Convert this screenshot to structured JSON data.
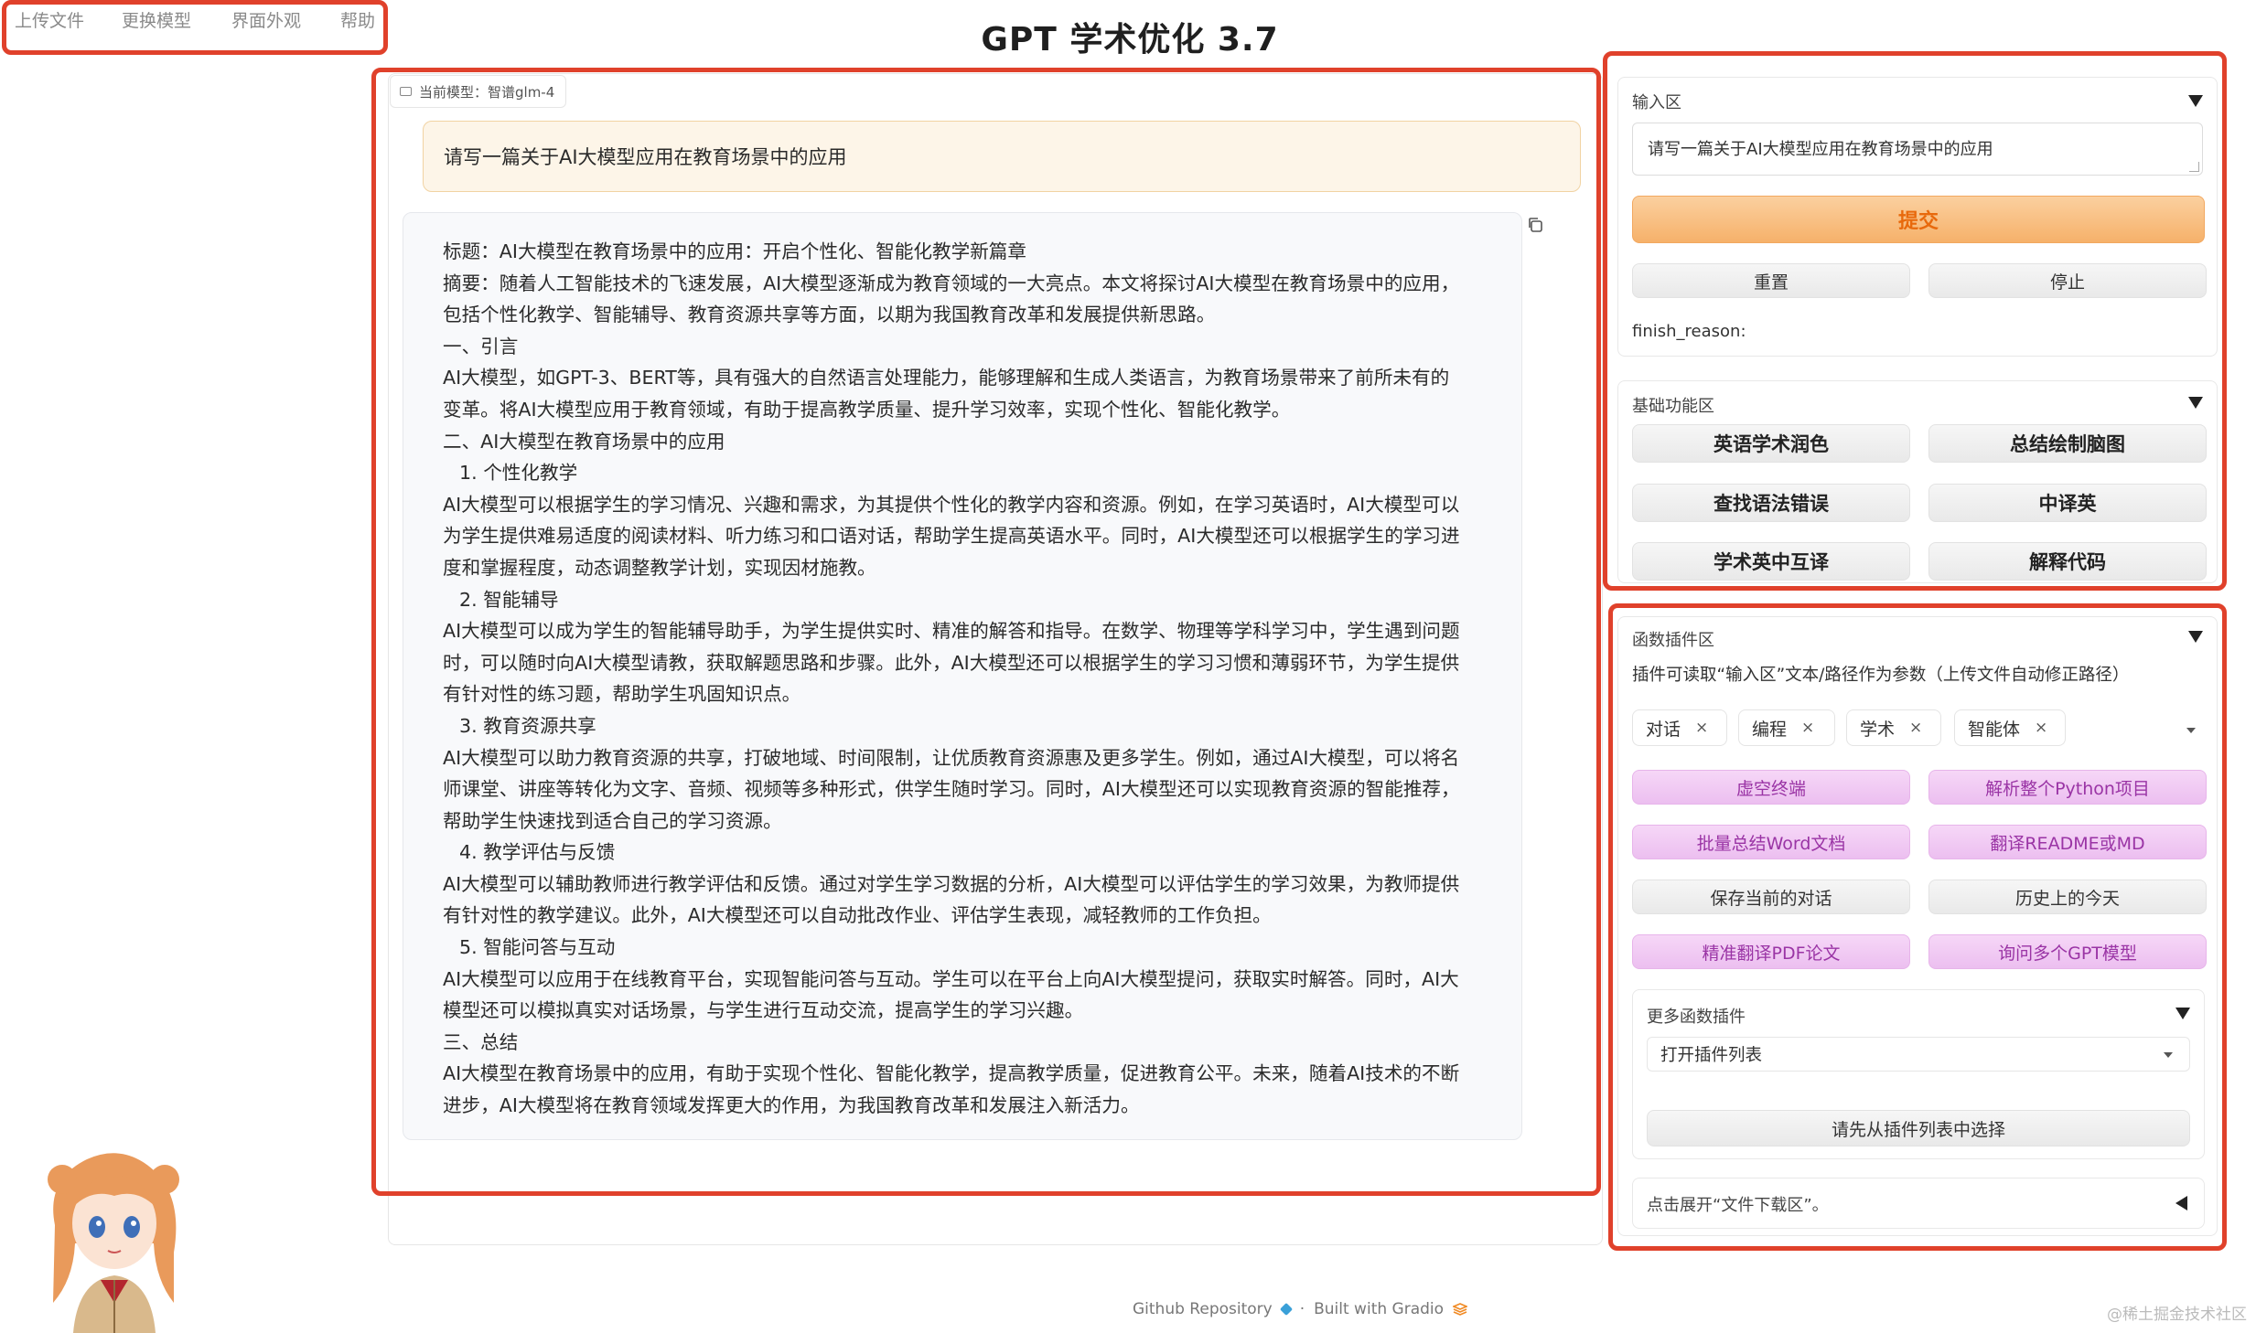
{
  "menu": [
    "上传文件",
    "更换模型",
    "界面外观",
    "帮助"
  ],
  "title": "GPT 学术优化 3.7",
  "chat": {
    "model_tag": "当前模型：智谱glm-4",
    "user_message": "请写一篇关于AI大模型应用在教育场景中的应用",
    "answer_lines": [
      {
        "text": "标题：AI大模型在教育场景中的应用：开启个性化、智能化教学新篇章",
        "indent": false
      },
      {
        "text": "摘要：随着人工智能技术的飞速发展，AI大模型逐渐成为教育领域的一大亮点。本文将探讨AI大模型在教育场景中的应用，",
        "indent": false
      },
      {
        "text": "包括个性化教学、智能辅导、教育资源共享等方面，以期为我国教育改革和发展提供新思路。",
        "indent": false
      },
      {
        "text": "一、引言",
        "indent": false
      },
      {
        "text": "AI大模型，如GPT-3、BERT等，具有强大的自然语言处理能力，能够理解和生成人类语言，为教育场景带来了前所未有的",
        "indent": false
      },
      {
        "text": "变革。将AI大模型应用于教育领域，有助于提高教学质量、提升学习效率，实现个性化、智能化教学。",
        "indent": false
      },
      {
        "text": "二、AI大模型在教育场景中的应用",
        "indent": false
      },
      {
        "text": "1. 个性化教学",
        "indent": true
      },
      {
        "text": "AI大模型可以根据学生的学习情况、兴趣和需求，为其提供个性化的教学内容和资源。例如，在学习英语时，AI大模型可以",
        "indent": false
      },
      {
        "text": "为学生提供难易适度的阅读材料、听力练习和口语对话，帮助学生提高英语水平。同时，AI大模型还可以根据学生的学习进",
        "indent": false
      },
      {
        "text": "度和掌握程度，动态调整教学计划，实现因材施教。",
        "indent": false
      },
      {
        "text": "2. 智能辅导",
        "indent": true
      },
      {
        "text": "AI大模型可以成为学生的智能辅导助手，为学生提供实时、精准的解答和指导。在数学、物理等学科学习中，学生遇到问题",
        "indent": false
      },
      {
        "text": "时，可以随时向AI大模型请教，获取解题思路和步骤。此外，AI大模型还可以根据学生的学习习惯和薄弱环节，为学生提供",
        "indent": false
      },
      {
        "text": "有针对性的练习题，帮助学生巩固知识点。",
        "indent": false
      },
      {
        "text": "3. 教育资源共享",
        "indent": true
      },
      {
        "text": "AI大模型可以助力教育资源的共享，打破地域、时间限制，让优质教育资源惠及更多学生。例如，通过AI大模型，可以将名",
        "indent": false
      },
      {
        "text": "师课堂、讲座等转化为文字、音频、视频等多种形式，供学生随时学习。同时，AI大模型还可以实现教育资源的智能推荐，",
        "indent": false
      },
      {
        "text": "帮助学生快速找到适合自己的学习资源。",
        "indent": false
      },
      {
        "text": "4. 教学评估与反馈",
        "indent": true
      },
      {
        "text": "AI大模型可以辅助教师进行教学评估和反馈。通过对学生学习数据的分析，AI大模型可以评估学生的学习效果，为教师提供",
        "indent": false
      },
      {
        "text": "有针对性的教学建议。此外，AI大模型还可以自动批改作业、评估学生表现，减轻教师的工作负担。",
        "indent": false
      },
      {
        "text": "5. 智能问答与互动",
        "indent": true
      },
      {
        "text": "AI大模型可以应用于在线教育平台，实现智能问答与互动。学生可以在平台上向AI大模型提问，获取实时解答。同时，AI大",
        "indent": false
      },
      {
        "text": "模型还可以模拟真实对话场景，与学生进行互动交流，提高学生的学习兴趣。",
        "indent": false
      },
      {
        "text": "三、总结",
        "indent": false
      },
      {
        "text": "AI大模型在教育场景中的应用，有助于实现个性化、智能化教学，提高教学质量，促进教育公平。未来，随着AI技术的不断",
        "indent": false
      },
      {
        "text": "进步，AI大模型将在教育领域发挥更大的作用，为我国教育改革和发展注入新活力。",
        "indent": false
      }
    ]
  },
  "input_area": {
    "label": "输入区",
    "value": "请写一篇关于AI大模型应用在教育场景中的应用",
    "submit": "提交",
    "reset": "重置",
    "stop": "停止",
    "finish_reason": "finish_reason:"
  },
  "basic": {
    "label": "基础功能区",
    "buttons": [
      "英语学术润色",
      "总结绘制脑图",
      "查找语法错误",
      "中译英",
      "学术英中互译",
      "解释代码"
    ]
  },
  "plugins": {
    "label": "函数插件区",
    "desc": "插件可读取“输入区”文本/路径作为参数（上传文件自动修正路径）",
    "chips": [
      "对话",
      "编程",
      "学术",
      "智能体"
    ],
    "chip_remove": "×",
    "buttons": [
      "虚空终端",
      "解析整个Python项目",
      "批量总结Word文档",
      "翻译README或MD",
      "保存当前的对话",
      "历史上的今天",
      "精准翻译PDF论文",
      "询问多个GPT模型"
    ],
    "more_label": "更多函数插件",
    "dropdown_value": "打开插件列表",
    "select_first": "请先从插件列表中选择"
  },
  "downloads": {
    "label": "点击展开“文件下载区”。"
  },
  "footer": {
    "github": "Github Repository",
    "gradio": "Built with Gradio",
    "sep": "·"
  },
  "watermark": "@稀土掘金技术社区",
  "colors": {
    "highlight": "#e0412b",
    "submit_text": "#e8690c",
    "plugin_pink": "#9a34a5"
  }
}
